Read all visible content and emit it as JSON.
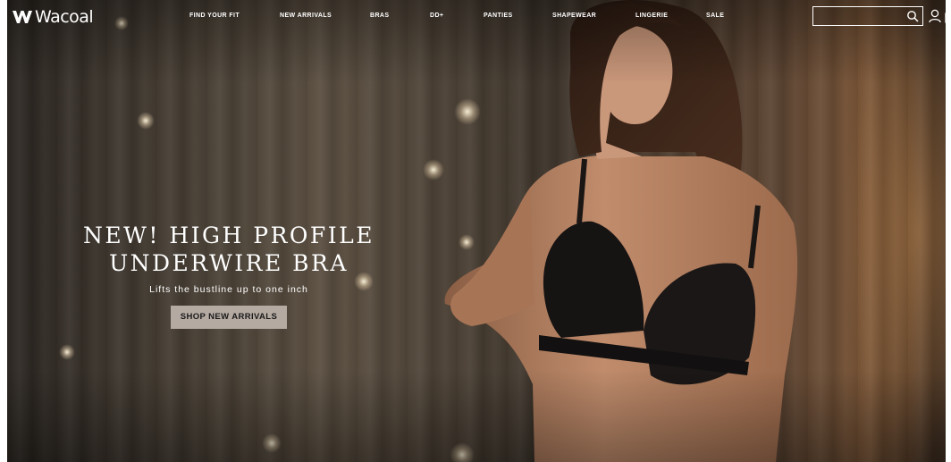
{
  "header": {
    "logo_text": "Wacoal",
    "nav": [
      {
        "label": "FIND YOUR FIT"
      },
      {
        "label": "NEW ARRIVALS"
      },
      {
        "label": "BRAS"
      },
      {
        "label": "DD+"
      },
      {
        "label": "PANTIES"
      },
      {
        "label": "SHAPEWEAR"
      },
      {
        "label": "LINGERIE"
      },
      {
        "label": "SALE"
      }
    ],
    "search": {
      "placeholder": "",
      "value": ""
    },
    "icons": [
      "search-icon",
      "account-icon",
      "shopping-bag-icon"
    ]
  },
  "hero": {
    "headline_line1": "NEW! HIGH PROFILE",
    "headline_line2": "UNDERWIRE BRA",
    "subhead": "Lifts the bustline up to one inch",
    "cta_label": "SHOP NEW ARRIVALS"
  },
  "colors": {
    "text": "#ffffff",
    "cta_bg": "#b4aaa2",
    "cta_text": "#1a1a1a"
  }
}
